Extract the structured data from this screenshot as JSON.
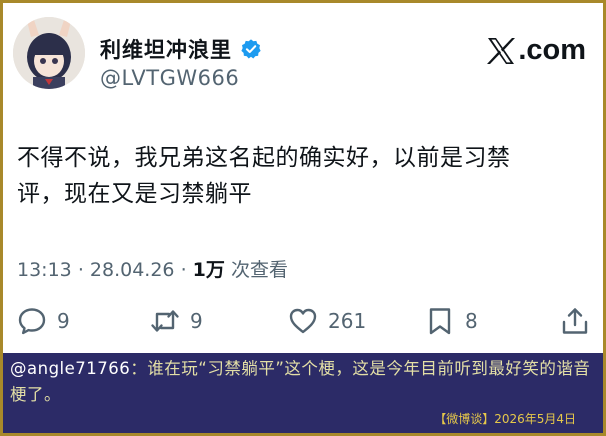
{
  "user": {
    "display_name": "利维坦冲浪里",
    "handle": "@LVTGW666"
  },
  "brand": {
    "text": ".com"
  },
  "tweet": {
    "line1": "不得不说，我兄弟这名起的确实好，以前是习禁",
    "line2": "评，现在又是习禁躺平"
  },
  "meta": {
    "time": "13:13",
    "date": "28.04.26",
    "views_count": "1万",
    "views_label": "次查看"
  },
  "actions": {
    "replies": "9",
    "reposts": "9",
    "likes": "261",
    "bookmarks": "8"
  },
  "caption": {
    "handle": "@angle71766",
    "text": "：谁在玩“习禁躺平”这个梗，这是今年目前听到最好笑的谐音梗了。"
  },
  "footer": {
    "tag": "【微博谈】2026年5月4日"
  },
  "colors": {
    "border": "#a8892a",
    "caption_bg": "#2c2b67",
    "caption_text": "#e3dfa6",
    "verified": "#1d9bf0"
  }
}
